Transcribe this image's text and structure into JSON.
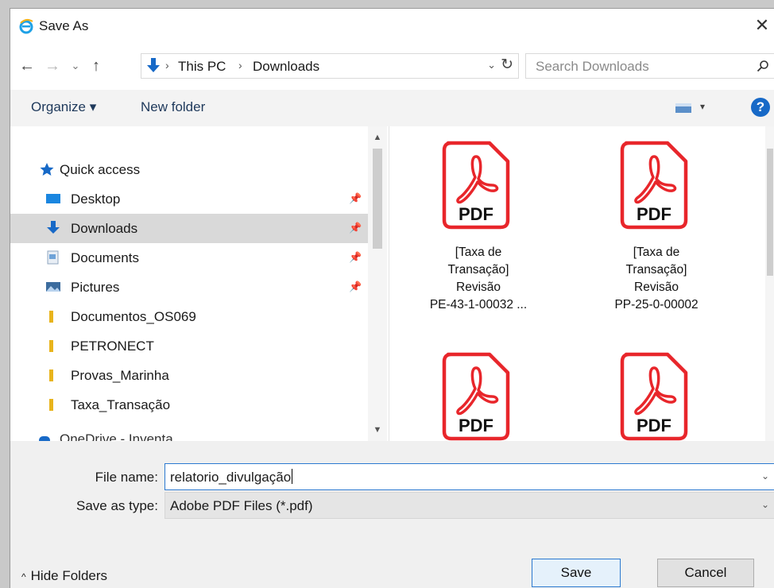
{
  "window": {
    "title": "Save As",
    "close_glyph": "✕",
    "icon": "ie-logo-icon"
  },
  "nav": {
    "back_glyph": "←",
    "forward_glyph": "→",
    "recent_glyph": "⌄",
    "up_glyph": "↑",
    "breadcrumb": [
      "This PC",
      "Downloads"
    ],
    "separator": "›",
    "dropdown_glyph": "⌄",
    "refresh_glyph": "↻"
  },
  "search": {
    "placeholder": "Search Downloads"
  },
  "toolbar": {
    "organize_label": "Organize ▾",
    "new_folder_label": "New folder",
    "view_dropdown_glyph": "▾",
    "help_label": "?"
  },
  "sidebar": {
    "quick_access": "Quick access",
    "items": [
      {
        "label": "Desktop",
        "icon": "desktop-icon",
        "pinned": true,
        "selected": false
      },
      {
        "label": "Downloads",
        "icon": "download-icon",
        "pinned": true,
        "selected": true
      },
      {
        "label": "Documents",
        "icon": "documents-icon",
        "pinned": true,
        "selected": false
      },
      {
        "label": "Pictures",
        "icon": "pictures-icon",
        "pinned": true,
        "selected": false
      },
      {
        "label": "Documentos_OS069",
        "icon": "folder-icon",
        "pinned": false,
        "selected": false
      },
      {
        "label": "PETRONECT",
        "icon": "folder-icon",
        "pinned": false,
        "selected": false
      },
      {
        "label": "Provas_Marinha",
        "icon": "folder-icon",
        "pinned": false,
        "selected": false
      },
      {
        "label": "Taxa_Transação",
        "icon": "folder-icon",
        "pinned": false,
        "selected": false
      }
    ],
    "pin_glyph": "📌",
    "partial_item": "OneDrive - Inventa"
  },
  "files": [
    {
      "icon_label": "PDF",
      "name_lines": [
        "[Taxa de",
        "Transação]",
        "Revisão",
        "PE-43-1-00032 ..."
      ]
    },
    {
      "icon_label": "PDF",
      "name_lines": [
        "[Taxa de",
        "Transação]",
        "Revisão",
        "PP-25-0-00002"
      ]
    },
    {
      "icon_label": "PDF",
      "name_lines": []
    },
    {
      "icon_label": "PDF",
      "name_lines": []
    }
  ],
  "form": {
    "file_name_label": "File name:",
    "file_name_value": "relatorio_divulgação",
    "save_type_label": "Save as type:",
    "save_type_value": "Adobe PDF Files (*.pdf)",
    "dropdown_glyph": "⌄"
  },
  "footer": {
    "hide_folders_label": "Hide Folders",
    "hide_chevron": "^",
    "save_label": "Save",
    "cancel_label": "Cancel"
  },
  "colors": {
    "accent": "#2b79d0",
    "pdf_red": "#e8262b",
    "selected_bg": "#d9d9d9"
  }
}
